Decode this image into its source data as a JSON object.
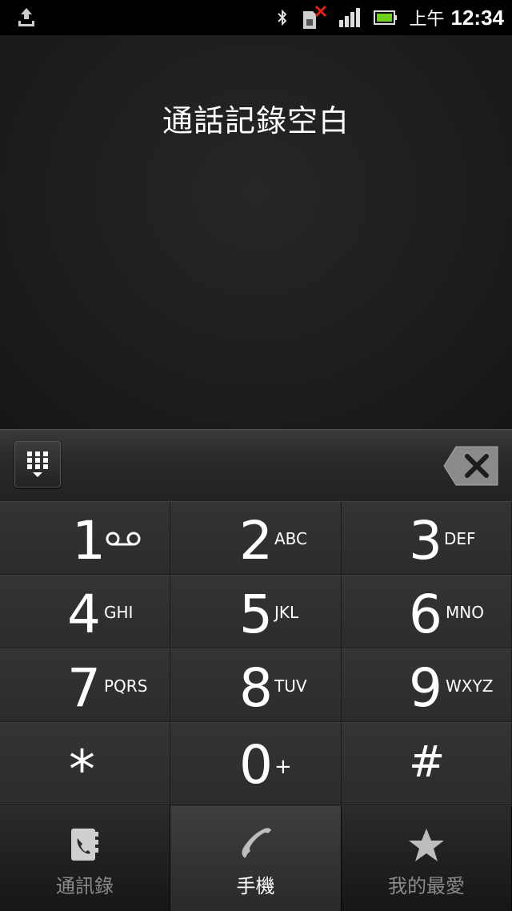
{
  "status_bar": {
    "ampm": "上午",
    "time": "12:34"
  },
  "call_log": {
    "empty_message": "通話記錄空白"
  },
  "keypad": {
    "keys": [
      {
        "digit": "1",
        "letters": ""
      },
      {
        "digit": "2",
        "letters": "ABC"
      },
      {
        "digit": "3",
        "letters": "DEF"
      },
      {
        "digit": "4",
        "letters": "GHI"
      },
      {
        "digit": "5",
        "letters": "JKL"
      },
      {
        "digit": "6",
        "letters": "MNO"
      },
      {
        "digit": "7",
        "letters": "PQRS"
      },
      {
        "digit": "8",
        "letters": "TUV"
      },
      {
        "digit": "9",
        "letters": "WXYZ"
      },
      {
        "digit": "*",
        "letters": ""
      },
      {
        "digit": "0",
        "letters": "+"
      },
      {
        "digit": "#",
        "letters": ""
      }
    ]
  },
  "tabs": [
    {
      "label": "通訊錄",
      "icon": "contacts-icon",
      "active": false
    },
    {
      "label": "手機",
      "icon": "phone-icon",
      "active": true
    },
    {
      "label": "我的最愛",
      "icon": "star-icon",
      "active": false
    }
  ]
}
